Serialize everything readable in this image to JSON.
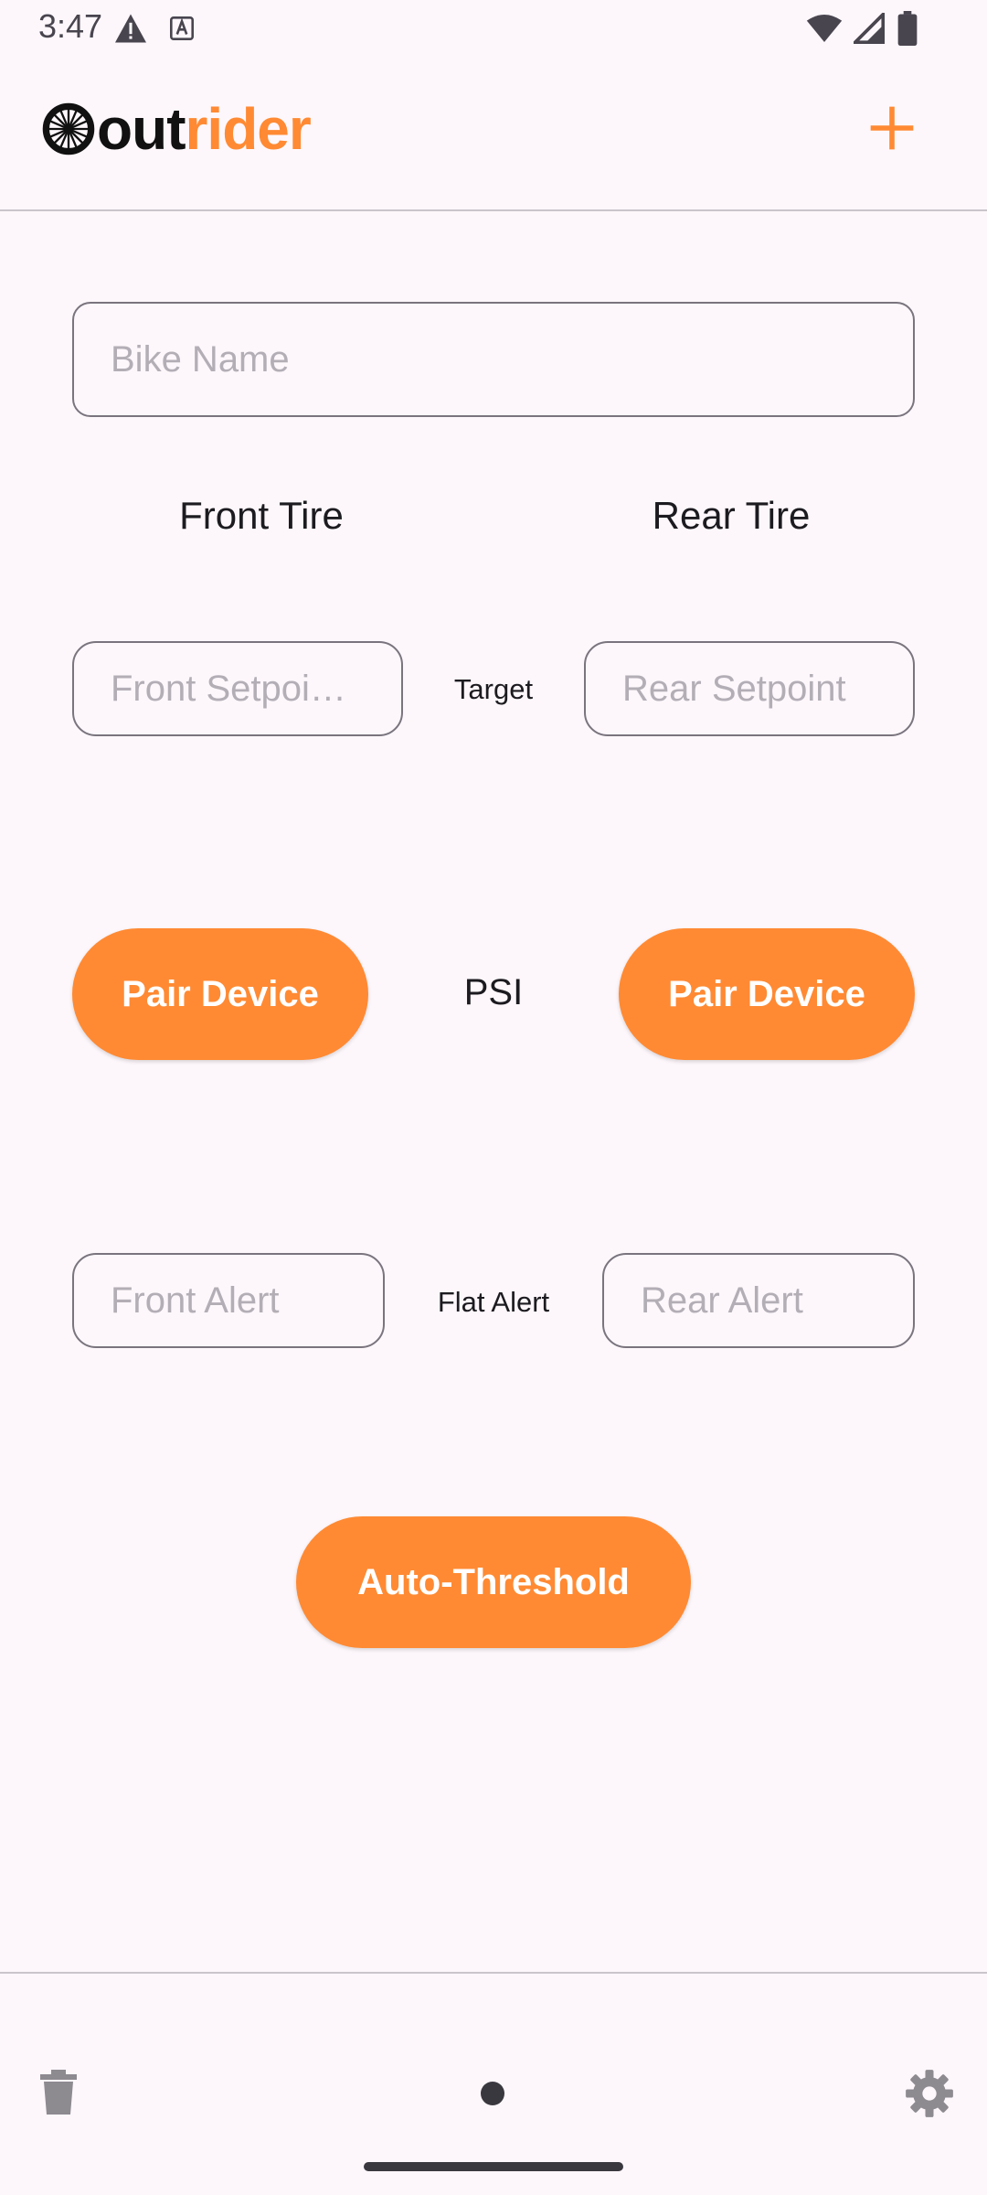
{
  "status_bar": {
    "time": "3:47",
    "icons": [
      "warning-icon",
      "a-notification-icon",
      "wifi-icon",
      "signal-icon",
      "battery-icon"
    ]
  },
  "app_bar": {
    "logo_dark": "out",
    "logo_orange": "rider",
    "add_icon": "plus-icon",
    "accent_color": "#ff8a33"
  },
  "form": {
    "bike_name_placeholder": "Bike Name",
    "front_tire_label": "Front Tire",
    "rear_tire_label": "Rear Tire",
    "front_setpoint_placeholder": "Front Setpoi…",
    "rear_setpoint_placeholder": "Rear Setpoint",
    "target_label": "Target",
    "pair_front_label": "Pair Device",
    "pair_rear_label": "Pair Device",
    "psi_label": "PSI",
    "front_alert_placeholder": "Front Alert",
    "rear_alert_placeholder": "Rear Alert",
    "flat_alert_label": "Flat Alert",
    "auto_threshold_label": "Auto-Threshold"
  },
  "bottom_bar": {
    "delete_icon": "trash-icon",
    "settings_icon": "gear-icon"
  }
}
